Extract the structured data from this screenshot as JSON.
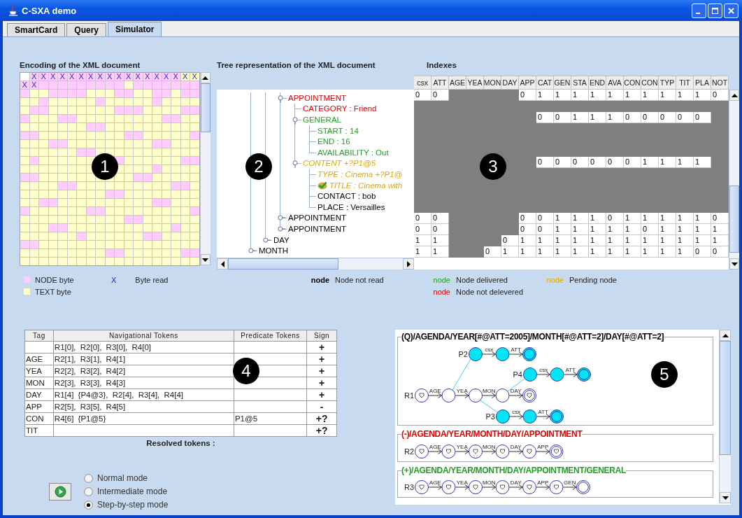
{
  "window": {
    "title": "C-SXA demo"
  },
  "tabs": [
    {
      "label": "SmartCard",
      "selected": false
    },
    {
      "label": "Query",
      "selected": false
    },
    {
      "label": "Simulator",
      "selected": true
    }
  ],
  "encoding": {
    "heading": "Encoding of the XML document",
    "rows": [
      {
        "cells": [
          {
            "kind": "empty"
          },
          {
            "kind": "node",
            "mark": "X"
          },
          {
            "kind": "node",
            "mark": "X"
          },
          {
            "kind": "node",
            "mark": "X"
          },
          {
            "kind": "node",
            "mark": "X"
          },
          {
            "kind": "node",
            "mark": "X"
          },
          {
            "kind": "node",
            "mark": "X"
          },
          {
            "kind": "node",
            "mark": "X"
          },
          {
            "kind": "node",
            "mark": "X"
          },
          {
            "kind": "node",
            "mark": "X"
          },
          {
            "kind": "node",
            "mark": "X"
          },
          {
            "kind": "node",
            "mark": "X"
          },
          {
            "kind": "node",
            "mark": "X"
          },
          {
            "kind": "node",
            "mark": "X"
          },
          {
            "kind": "node",
            "mark": "X"
          },
          {
            "kind": "node",
            "mark": "X"
          },
          {
            "kind": "node",
            "mark": "X"
          },
          {
            "kind": "text",
            "mark": "X"
          },
          {
            "kind": "text",
            "mark": "X"
          }
        ]
      },
      {
        "cells": [
          {
            "kind": "node",
            "mark": "X"
          },
          {
            "kind": "node",
            "mark": "X"
          },
          {
            "kind": "node"
          },
          {
            "kind": "node"
          },
          {
            "kind": "node"
          },
          {
            "kind": "node"
          },
          {
            "kind": "node"
          },
          {
            "kind": "node"
          },
          {
            "kind": "node"
          },
          {
            "kind": "node"
          },
          {
            "kind": "node"
          },
          {
            "kind": "text"
          },
          {
            "kind": "node"
          },
          {
            "kind": "node"
          },
          {
            "kind": "node"
          },
          {
            "kind": "node"
          },
          {
            "kind": "node"
          },
          {
            "kind": "node"
          },
          {
            "kind": "node"
          }
        ]
      },
      {
        "node": [
          true,
          false,
          false,
          true,
          true,
          true,
          true,
          false,
          false,
          false,
          true,
          true,
          false,
          false,
          true,
          true,
          false,
          true,
          true
        ]
      },
      {
        "node": [
          false,
          false,
          true,
          false,
          false,
          false,
          false,
          false,
          true,
          false,
          false,
          false,
          false,
          false,
          true,
          false,
          false,
          false,
          false
        ]
      },
      {
        "node": [
          false,
          true,
          true,
          false,
          false,
          false,
          false,
          false,
          false,
          false,
          true,
          true,
          true,
          false,
          false,
          false,
          false,
          true,
          true
        ]
      },
      {
        "node": [
          true,
          false,
          false,
          false,
          true,
          true,
          false,
          false,
          false,
          false,
          false,
          false,
          false,
          false,
          false,
          true,
          true,
          false,
          false
        ]
      },
      {
        "node": [
          false,
          false,
          false,
          false,
          false,
          false,
          false,
          true,
          true,
          false,
          false,
          false,
          false,
          false,
          false,
          false,
          false,
          false,
          false
        ]
      },
      {
        "node": [
          true,
          true,
          false,
          false,
          false,
          false,
          false,
          false,
          false,
          false,
          false,
          true,
          true,
          false,
          false,
          false,
          false,
          false,
          true
        ]
      },
      {
        "node": [
          false,
          false,
          false,
          true,
          true,
          false,
          false,
          false,
          false,
          false,
          false,
          false,
          false,
          false,
          true,
          true,
          false,
          false,
          false
        ]
      },
      {
        "node": [
          false,
          false,
          false,
          false,
          false,
          false,
          true,
          true,
          false,
          false,
          false,
          false,
          false,
          false,
          false,
          false,
          false,
          false,
          false
        ]
      },
      {
        "cells": [
          {
            "kind": "text"
          },
          {
            "kind": "node"
          },
          {
            "kind": "text"
          },
          {
            "kind": "text"
          },
          {
            "kind": "text"
          },
          {
            "kind": "text"
          },
          {
            "kind": "text"
          },
          {
            "kind": "text"
          },
          {
            "kind": "covered"
          },
          {
            "kind": "covered"
          },
          {
            "kind": "node"
          },
          {
            "kind": "text"
          },
          {
            "kind": "text"
          },
          {
            "kind": "text"
          },
          {
            "kind": "text"
          },
          {
            "kind": "text"
          },
          {
            "kind": "text"
          },
          {
            "kind": "node"
          },
          {
            "kind": "node"
          }
        ]
      },
      {
        "cells": [
          {
            "kind": "text"
          },
          {
            "kind": "text"
          },
          {
            "kind": "text"
          },
          {
            "kind": "text"
          },
          {
            "kind": "text"
          },
          {
            "kind": "text"
          },
          {
            "kind": "text"
          },
          {
            "kind": "text"
          },
          {
            "kind": "covered"
          },
          {
            "kind": "covered"
          },
          {
            "kind": "text"
          },
          {
            "kind": "text"
          },
          {
            "kind": "text"
          },
          {
            "kind": "text"
          },
          {
            "kind": "node"
          },
          {
            "kind": "text"
          },
          {
            "kind": "text"
          },
          {
            "kind": "text"
          },
          {
            "kind": "text"
          }
        ]
      },
      {
        "node": [
          true,
          true,
          false,
          false,
          false,
          false,
          false,
          false,
          false,
          false,
          false,
          false,
          true,
          true,
          false,
          false,
          false,
          false,
          false
        ]
      },
      {
        "node": [
          false,
          false,
          false,
          false,
          true,
          true,
          false,
          false,
          false,
          false,
          false,
          false,
          false,
          false,
          false,
          false,
          true,
          true,
          false
        ]
      },
      {
        "node": [
          false,
          false,
          false,
          false,
          false,
          false,
          false,
          false,
          false,
          true,
          true,
          false,
          false,
          false,
          false,
          false,
          false,
          false,
          false
        ]
      },
      {
        "node": [
          false,
          false,
          true,
          true,
          false,
          false,
          false,
          false,
          false,
          false,
          false,
          false,
          false,
          false,
          true,
          true,
          false,
          false,
          false
        ]
      },
      {
        "node": [
          true,
          false,
          false,
          false,
          false,
          false,
          false,
          true,
          true,
          false,
          false,
          false,
          false,
          false,
          false,
          false,
          false,
          false,
          true
        ]
      },
      {
        "node": [
          false,
          false,
          false,
          false,
          false,
          false,
          false,
          false,
          false,
          false,
          false,
          true,
          true,
          false,
          false,
          false,
          false,
          false,
          false
        ]
      },
      {
        "node": [
          false,
          false,
          false,
          true,
          true,
          false,
          false,
          false,
          false,
          false,
          false,
          false,
          false,
          false,
          false,
          false,
          true,
          false,
          false
        ]
      },
      {
        "node": [
          false,
          false,
          false,
          false,
          false,
          false,
          true,
          false,
          false,
          false,
          false,
          false,
          false,
          true,
          true,
          false,
          false,
          false,
          false
        ]
      },
      {
        "node": [
          true,
          true,
          false,
          false,
          false,
          false,
          false,
          false,
          false,
          false,
          false,
          false,
          false,
          false,
          false,
          false,
          false,
          false,
          false
        ]
      },
      {
        "node": [
          false,
          false,
          false,
          false,
          false,
          false,
          false,
          false,
          false,
          true,
          true,
          false,
          false,
          false,
          false,
          false,
          false,
          true,
          true
        ]
      },
      {
        "node": [
          false,
          false,
          false,
          false,
          false,
          false,
          false,
          false,
          false,
          false,
          false,
          false,
          false,
          false,
          false,
          false,
          false,
          false,
          false
        ]
      }
    ]
  },
  "tree": {
    "heading": "Tree representation of the XML document",
    "nodes": [
      {
        "children": [
          {
            "children": [
              {
                "label": "APPOINTMENT",
                "kind": "not_delivered",
                "expanded": true,
                "children": [
                  {
                    "label": "CATEGORY : Friend",
                    "kind": "not_delivered"
                  },
                  {
                    "label": "GENERAL",
                    "kind": "delivered",
                    "expanded": true,
                    "children": [
                      {
                        "label": "START : 14",
                        "kind": "delivered"
                      },
                      {
                        "label": "END : 16",
                        "kind": "delivered"
                      },
                      {
                        "label": "AVAILABILITY : Out",
                        "kind": "delivered"
                      }
                    ]
                  },
                  {
                    "label": "CONTENT +?P1@5",
                    "kind": "pending",
                    "expanded": true,
                    "children": [
                      {
                        "label": "TYPE : Cinema +?P1@",
                        "kind": "pending"
                      },
                      {
                        "label": "TITLE : Cinema with",
                        "kind": "pending",
                        "verified": true
                      },
                      {
                        "label": "CONTACT : bob",
                        "kind": "not_read"
                      },
                      {
                        "label": "PLACE : Versailles",
                        "kind": "not_read"
                      }
                    ]
                  }
                ]
              },
              {
                "label": "APPOINTMENT",
                "kind": "not_read",
                "expanded": false
              },
              {
                "label": "APPOINTMENT",
                "kind": "not_read",
                "expanded": false
              }
            ]
          },
          {
            "label": "DAY",
            "kind": "not_read",
            "expanded": false
          }
        ]
      },
      {
        "label": "MONTH",
        "kind": "not_read",
        "expanded": false
      }
    ]
  },
  "indexes": {
    "heading": "Indexes",
    "columns": [
      "csx",
      "ATT",
      "AGE",
      "YEA",
      "MON",
      "DAY",
      "APP",
      "CAT",
      "GEN",
      "STA",
      "END",
      "AVA",
      "CON",
      "CON",
      "TYP",
      "TIT",
      "PLA",
      "NOT"
    ],
    "rows": [
      {
        "cells": [
          "0",
          "0",
          null,
          null,
          null,
          null,
          "0",
          "1",
          "1",
          "1",
          "1",
          "1",
          "1",
          "1",
          "1",
          "1",
          "1",
          "0"
        ]
      },
      {
        "cells": [
          null,
          null,
          null,
          null,
          null,
          null,
          null,
          null,
          null,
          null,
          null,
          null,
          null,
          null,
          null,
          null,
          null,
          null
        ]
      },
      {
        "cells": [
          null,
          null,
          null,
          null,
          null,
          null,
          null,
          "0",
          "0",
          "1",
          "1",
          "1",
          "0",
          "0",
          "0",
          "0",
          "0",
          null
        ]
      },
      {
        "cells": [
          null,
          null,
          null,
          null,
          null,
          null,
          null,
          null,
          null,
          null,
          null,
          null,
          null,
          null,
          null,
          null,
          null,
          null
        ]
      },
      {
        "cells": [
          null,
          null,
          null,
          null,
          null,
          null,
          null,
          null,
          null,
          null,
          null,
          null,
          null,
          null,
          null,
          null,
          null,
          null
        ]
      },
      {
        "cells": [
          null,
          null,
          null,
          null,
          null,
          null,
          null,
          null,
          null,
          null,
          null,
          null,
          null,
          null,
          null,
          null,
          null,
          null
        ]
      },
      {
        "cells": [
          null,
          null,
          null,
          null,
          null,
          null,
          null,
          "0",
          "0",
          "0",
          "0",
          "0",
          "0",
          "1",
          "1",
          "1",
          "1",
          null
        ]
      },
      {
        "cells": [
          null,
          null,
          null,
          null,
          null,
          null,
          null,
          null,
          null,
          null,
          null,
          null,
          null,
          null,
          null,
          null,
          null,
          null
        ]
      },
      {
        "cells": [
          null,
          null,
          null,
          null,
          null,
          null,
          null,
          null,
          null,
          null,
          null,
          null,
          null,
          null,
          null,
          null,
          null,
          null
        ]
      },
      {
        "cells": [
          null,
          null,
          null,
          null,
          null,
          null,
          null,
          null,
          null,
          null,
          null,
          null,
          null,
          null,
          null,
          null,
          null,
          null
        ]
      },
      {
        "cells": [
          null,
          null,
          null,
          null,
          null,
          null,
          null,
          null,
          null,
          null,
          null,
          null,
          null,
          null,
          null,
          null,
          null,
          null
        ]
      },
      {
        "cells": [
          "0",
          "0",
          null,
          null,
          null,
          null,
          "0",
          "0",
          "1",
          "1",
          "1",
          "0",
          "1",
          "1",
          "1",
          "1",
          "1",
          "0"
        ]
      },
      {
        "cells": [
          "0",
          "0",
          null,
          null,
          null,
          null,
          "0",
          "0",
          "1",
          "1",
          "1",
          "1",
          "1",
          "0",
          "1",
          "1",
          "1",
          "1"
        ]
      },
      {
        "cells": [
          "1",
          "1",
          null,
          null,
          null,
          "0",
          "1",
          "1",
          "1",
          "1",
          "1",
          "1",
          "1",
          "1",
          "1",
          "1",
          "1",
          "1"
        ]
      },
      {
        "cells": [
          "1",
          "1",
          null,
          null,
          "0",
          "1",
          "1",
          "1",
          "1",
          "1",
          "1",
          "1",
          "1",
          "1",
          "1",
          "1",
          "0",
          "0"
        ]
      }
    ]
  },
  "legend": {
    "bytes": [
      {
        "label": "NODE byte",
        "color": "#ffccff"
      },
      {
        "label": "TEXT byte",
        "color": "#ffffcc"
      }
    ],
    "read": {
      "mark": "X",
      "label": "Byte read"
    },
    "nodes": [
      {
        "mark": "node",
        "label": "Node not read",
        "kind": "not_read"
      },
      {
        "mark": "node",
        "label": "Node delivered",
        "kind": "delivered"
      },
      {
        "mark": "node",
        "label": "Pending node",
        "kind": "pending"
      },
      {
        "mark": "node",
        "label": "Node not delevered",
        "kind": "not_delivered"
      }
    ]
  },
  "tokens": {
    "columns": [
      "Tag",
      "Navigational Tokens",
      "Predicate Tokens",
      "Sign"
    ],
    "rows": [
      {
        "navigational": "R1[0], R2[0], R3[0], R4[0]",
        "sign": "+"
      },
      {
        "tag": "AGE",
        "navigational": "R2[1], R3[1], R4[1]",
        "sign": "+"
      },
      {
        "tag": "YEA",
        "navigational": "R2[2], R3[2], R4[2]",
        "sign": "+"
      },
      {
        "tag": "MON",
        "navigational": "R2[3], R3[3], R4[3]",
        "sign": "+"
      },
      {
        "tag": "DAY",
        "navigational": "R1[4] {P4@3}, R2[4], R3[4], R4[4]",
        "sign": "+"
      },
      {
        "tag": "APP",
        "navigational": "R2[5], R3[5], R4[5]",
        "sign": "-"
      },
      {
        "tag": "CON",
        "navigational": "R4[6] {P1@5}",
        "predicate": "P1@5",
        "sign": "+?"
      },
      {
        "tag": "TIT",
        "sign": "+?"
      }
    ],
    "resolved_label": "Resolved tokens :"
  },
  "modes": [
    {
      "label": "Normal mode",
      "selected": false
    },
    {
      "label": "Intermediate mode",
      "selected": false
    },
    {
      "label": "Step-by-step mode",
      "selected": true
    }
  ],
  "automata": {
    "groups": [
      {
        "title": "(Q)/AGENDA/YEAR[#@ATT=2005]/MONTH[#@ATT=2]/DAY[#@ATT=2]",
        "kind": "query",
        "chains": [
          {
            "name": "P2",
            "labels": [
              "csx",
              "ATT"
            ],
            "active": true,
            "marked": [
              false,
              false,
              false
            ]
          },
          {
            "name": "P4",
            "labels": [
              "csx",
              "ATT"
            ],
            "active": true,
            "marked": [
              false,
              false,
              false
            ]
          },
          {
            "name": "R1",
            "labels": [
              "AGE",
              "YEA",
              "MON",
              "DAY"
            ],
            "active": false,
            "marked": [
              true,
              false,
              false,
              false,
              true
            ]
          },
          {
            "name": "P3",
            "labels": [
              "csx",
              "ATT"
            ],
            "active": true,
            "marked": [
              false,
              false,
              false
            ]
          }
        ]
      },
      {
        "title": "(-)/AGENDA/YEAR/MONTH/DAY/APPOINTMENT",
        "kind": "negative",
        "chains": [
          {
            "name": "R2",
            "labels": [
              "AGE",
              "YEA",
              "MON",
              "DAY",
              "APP"
            ],
            "active": false,
            "marked": [
              true,
              true,
              true,
              true,
              true,
              true
            ]
          }
        ]
      },
      {
        "title": "(+)/AGENDA/YEAR/MONTH/DAY/APPOINTMENT/GENERAL",
        "kind": "positive",
        "chains": [
          {
            "name": "R3",
            "labels": [
              "AGE",
              "YEA",
              "MON",
              "DAY",
              "APP",
              "GEN"
            ],
            "active": false,
            "marked": [
              true,
              true,
              true,
              true,
              true,
              true,
              false
            ]
          }
        ]
      }
    ]
  },
  "callouts": [
    "1",
    "2",
    "3",
    "4",
    "5"
  ]
}
